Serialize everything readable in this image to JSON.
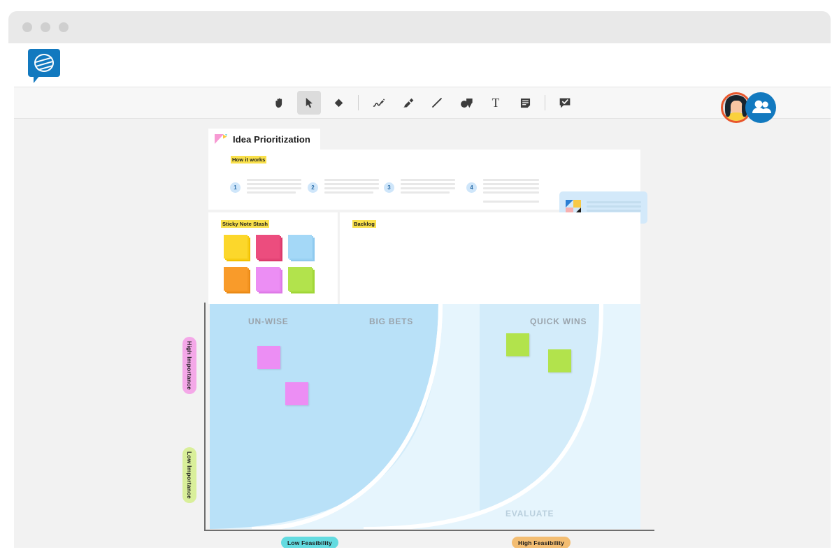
{
  "window": {
    "dots": [
      "close-dot",
      "minimize-dot",
      "maximize-dot"
    ]
  },
  "header": {
    "logo_name": "mural-logo",
    "nav_placeholders": [
      "",
      "",
      ""
    ],
    "avatars": [
      {
        "name": "collaborator-1",
        "ring": "#8b3fa8"
      },
      {
        "name": "collaborator-2",
        "ring": "#e8562c"
      },
      {
        "name": "current-user",
        "ring": "#12a5a5"
      }
    ],
    "add_people_label": ""
  },
  "toolbar": {
    "tools": [
      {
        "id": "hand",
        "label": "Hand",
        "icon": "hand-icon",
        "active": false
      },
      {
        "id": "select",
        "label": "Select",
        "icon": "cursor-icon",
        "active": true
      },
      {
        "id": "eraser",
        "label": "Eraser",
        "icon": "eraser-icon",
        "active": false
      },
      {
        "id": "pen",
        "label": "Pen",
        "icon": "pen-icon",
        "active": false
      },
      {
        "id": "marker",
        "label": "Marker",
        "icon": "marker-icon",
        "active": false
      },
      {
        "id": "line",
        "label": "Line",
        "icon": "line-icon",
        "active": false
      },
      {
        "id": "shapes",
        "label": "Shapes",
        "icon": "shapes-icon",
        "active": false
      },
      {
        "id": "text",
        "label": "Text",
        "icon": "text-icon",
        "active": false
      },
      {
        "id": "sticky",
        "label": "Sticky note",
        "icon": "sticky-note-icon",
        "active": false
      },
      {
        "id": "comment",
        "label": "Comment",
        "icon": "comment-icon",
        "active": false
      }
    ]
  },
  "board": {
    "title": "Idea Prioritization",
    "title_icon": "pennant-icon",
    "howitworks": {
      "label": "How it works",
      "steps": [
        {
          "number": "1",
          "lines": 4
        },
        {
          "number": "2",
          "lines": 4
        },
        {
          "number": "3",
          "lines": 4
        },
        {
          "number": "4",
          "lines": 5
        }
      ],
      "media_card": {
        "thumb_icon": "image-thumb-icon",
        "lines": 3
      }
    },
    "stash": {
      "label": "Sticky Note Stash",
      "colors": [
        {
          "name": "yellow",
          "hex": "#fcd72b",
          "shadow": "#f2c200"
        },
        {
          "name": "pink",
          "hex": "#ec4d7e",
          "shadow": "#db3a6c"
        },
        {
          "name": "blue",
          "hex": "#a4d8f7",
          "shadow": "#8ec9ef"
        },
        {
          "name": "orange",
          "hex": "#f99b2a",
          "shadow": "#ea8a16"
        },
        {
          "name": "violet",
          "hex": "#ec8ef4",
          "shadow": "#de7ae7"
        },
        {
          "name": "green",
          "hex": "#b2e34c",
          "shadow": "#a0d637"
        }
      ]
    },
    "backlog": {
      "label": "Backlog"
    }
  },
  "chart_data": {
    "type": "scatter",
    "title": "Idea Prioritization",
    "xlabel": "Feasibility",
    "ylabel": "Importance",
    "xlim": [
      "Low Feasibility",
      "High Feasibility"
    ],
    "ylim": [
      "Low Importance",
      "High Importance"
    ],
    "grid": false,
    "legend": "none",
    "zones": [
      {
        "name": "UN-WISE",
        "color": "#b9e1f8",
        "label_x": 0.14,
        "label_y": 0.08
      },
      {
        "name": "BIG BETS",
        "color": "#d3ecfa",
        "label_x": 0.41,
        "label_y": 0.08
      },
      {
        "name": "QUICK WINS",
        "color": "#e6f5fd",
        "label_x": 0.8,
        "label_y": 0.08
      },
      {
        "name": "EVALUATE",
        "color": "#d3ecfa",
        "label_x": 0.74,
        "label_y": 0.94
      }
    ],
    "points": [
      {
        "id": "note-1",
        "color": "#ec8ef4",
        "x": 0.12,
        "y": 0.24,
        "zone": "UN-WISE"
      },
      {
        "id": "note-2",
        "color": "#ec8ef4",
        "x": 0.18,
        "y": 0.4,
        "zone": "UN-WISE"
      },
      {
        "id": "note-3",
        "color": "#b2e34c",
        "x": 0.69,
        "y": 0.18,
        "zone": "QUICK WINS"
      },
      {
        "id": "note-4",
        "color": "#b2e34c",
        "x": 0.79,
        "y": 0.25,
        "zone": "QUICK WINS"
      }
    ],
    "axis_pills": [
      {
        "text": "High Importance",
        "bg": "#f4a8e8",
        "orient": "vertical",
        "pos": "top-left"
      },
      {
        "text": "Low Importance",
        "bg": "#d9ef9a",
        "orient": "vertical",
        "pos": "bottom-left"
      },
      {
        "text": "Low Feasibility",
        "bg": "#63dbe0",
        "orient": "horizontal",
        "pos": "bottom-left"
      },
      {
        "text": "High Feasibility",
        "bg": "#f3bd72",
        "orient": "horizontal",
        "pos": "bottom-right"
      }
    ]
  }
}
